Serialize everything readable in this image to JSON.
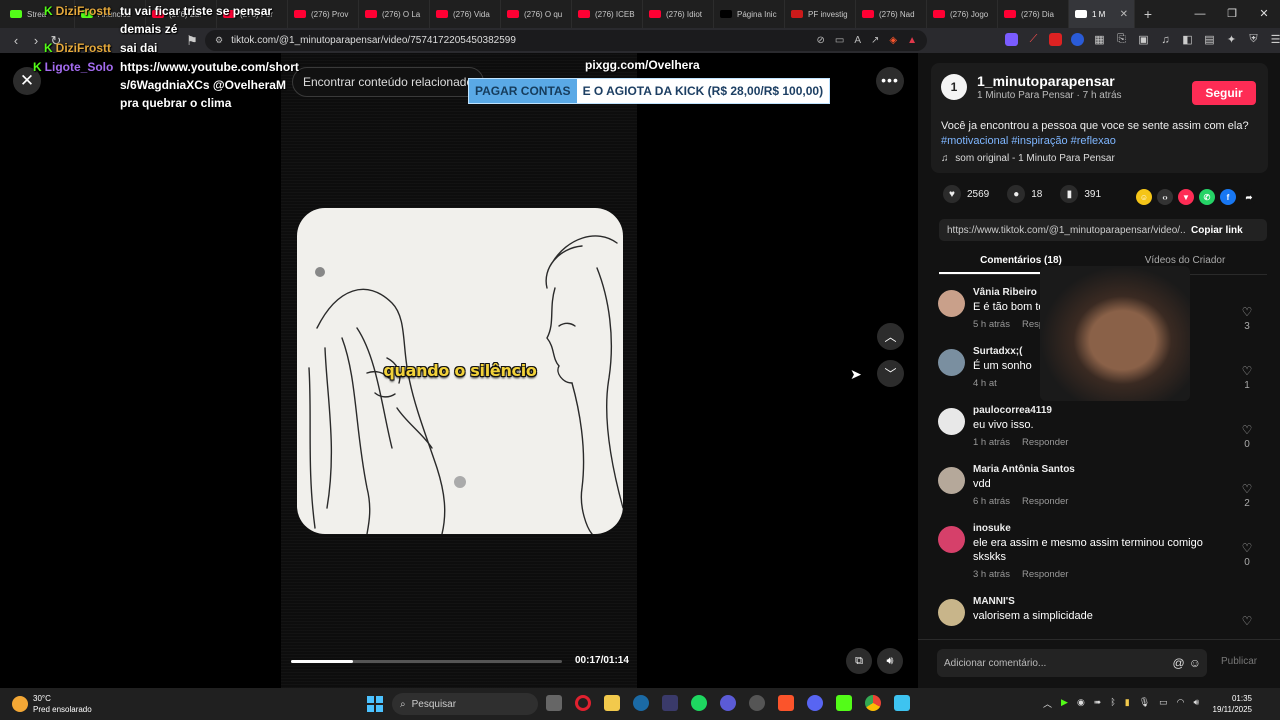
{
  "browser": {
    "tabs": [
      {
        "label": "Strea",
        "color": "#53fc18"
      },
      {
        "label": "Anúncios",
        "color": "#53fc18"
      },
      {
        "label": "(276) Zul",
        "color": "#ff0033"
      },
      {
        "label": "(276) For",
        "color": "#ff0033"
      },
      {
        "label": "(276) Prov",
        "color": "#ff0033"
      },
      {
        "label": "(276) O La",
        "color": "#ff0033"
      },
      {
        "label": "(276) Vida",
        "color": "#ff0033"
      },
      {
        "label": "(276) O qu",
        "color": "#ff0033"
      },
      {
        "label": "(276) ICEB",
        "color": "#ff0033"
      },
      {
        "label": "(276) Idiot",
        "color": "#ff0033"
      },
      {
        "label": "Página Inic",
        "color": "#000000"
      },
      {
        "label": "PF investig",
        "color": "#cc1a1a"
      },
      {
        "label": "(276) Nad",
        "color": "#ff0033"
      },
      {
        "label": "(276) Jogo",
        "color": "#ff0033"
      },
      {
        "label": "(276) Dia",
        "color": "#ff0033"
      },
      {
        "label": "1 M",
        "color": "#ffffff"
      }
    ],
    "url": "tiktok.com/@1_minutoparapensar/video/7574172205450382599"
  },
  "stream_overlay": {
    "chat": [
      {
        "user": "DiziFrostt",
        "message": "tu vai ficar triste se pensar"
      },
      {
        "user": "",
        "message": "demais zé"
      },
      {
        "user": "DiziFrostt",
        "message": "sai dai"
      },
      {
        "user": "Ligote_Solo",
        "message": "https://www.youtube.com/short"
      },
      {
        "user": "",
        "message": "s/6WagdniaXCs @OvelheraM"
      },
      {
        "user": "",
        "message": "pra quebrar o clima"
      }
    ],
    "pixgg": "pixgg.com/Ovelhera",
    "donation_label": "PAGAR CONTAS",
    "donation_message": "E O AGIOTA DA KICK (R$ 28,00/R$ 100,00)"
  },
  "video": {
    "related_search": "Encontrar conteúdo relacionado",
    "caption": "quando o silêncio",
    "time": "00:17/01:14",
    "progress": 0.23
  },
  "author": {
    "avatar_text": "1",
    "handle": "1_minutoparapensar",
    "meta": "1 Minuto Para Pensar · 7 h atrás",
    "follow_label": "Seguir",
    "description": "Você ja encontrou a pessoa que voce se sente assim com ela?",
    "tags": "#motivacional #inspiração #reflexao",
    "sound": "som original - 1 Minuto Para Pensar"
  },
  "stats": {
    "likes": "2569",
    "comments": "18",
    "saves": "391"
  },
  "share": {
    "link": "https://www.tiktok.com/@1_minutoparapensar/video/...",
    "copy_label": "Copiar link",
    "icons": [
      {
        "name": "coin",
        "color": "#f5c518",
        "glyph": "☺"
      },
      {
        "name": "embed",
        "color": "#333333",
        "glyph": "‹›"
      },
      {
        "name": "send",
        "color": "#fe2c55",
        "glyph": "▼"
      },
      {
        "name": "whatsapp",
        "color": "#25d366",
        "glyph": "✆"
      },
      {
        "name": "facebook",
        "color": "#1877f2",
        "glyph": "f"
      },
      {
        "name": "more",
        "color": "#121212",
        "glyph": "➦"
      }
    ]
  },
  "tabs": {
    "comments_label": "Comentários (18)",
    "videos_label": "Vídeos do Criador"
  },
  "comments": [
    {
      "user": "Vânia Ribeiro",
      "text": "E é tão bom ter e",
      "time": "5 h atrás",
      "reply": "Respon",
      "likes": "3",
      "color": "#c9a08a"
    },
    {
      "user": "Surtadxx;(",
      "text": "É um sonho",
      "time": "4 h at",
      "reply": "",
      "likes": "1",
      "color": "#7a8fa0"
    },
    {
      "user": "paulocorrea4119",
      "text": "eu vivo isso.",
      "time": "1 h atrás",
      "reply": "Responder",
      "likes": "0",
      "color": "#e8e8e8"
    },
    {
      "user": "Maria Antônia Santos",
      "text": "vdd",
      "time": "6 h atrás",
      "reply": "Responder",
      "likes": "2",
      "color": "#b5a89a"
    },
    {
      "user": "inosuke",
      "text": "ele era assim e mesmo assim terminou comigo skskks",
      "time": "3 h atrás",
      "reply": "Responder",
      "likes": "0",
      "color": "#d6406a"
    },
    {
      "user": "MANNI'S",
      "text": "valorisem a simplicidade",
      "time": "",
      "reply": "",
      "likes": "",
      "color": "#c8b58a"
    }
  ],
  "comment_box": {
    "placeholder": "Adicionar comentário...",
    "publish_label": "Publicar"
  },
  "taskbar": {
    "temp": "30°C",
    "weather": "Pred ensolarado",
    "search": "Pesquisar",
    "time": "01:35",
    "date": "19/11/2025"
  }
}
